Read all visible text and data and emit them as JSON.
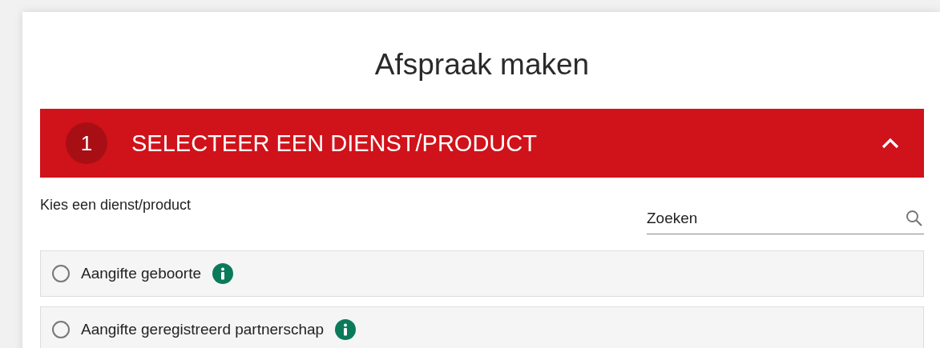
{
  "page": {
    "title": "Afspraak maken"
  },
  "step": {
    "number": "1",
    "title": "SELECTEER EEN DIENST/PRODUCT",
    "expanded": true
  },
  "prompt": "Kies een dienst/product",
  "search": {
    "placeholder": "Zoeken"
  },
  "options": [
    {
      "label": "Aangifte geboorte",
      "selected": false
    },
    {
      "label": "Aangifte geregistreerd partnerschap",
      "selected": false
    }
  ]
}
